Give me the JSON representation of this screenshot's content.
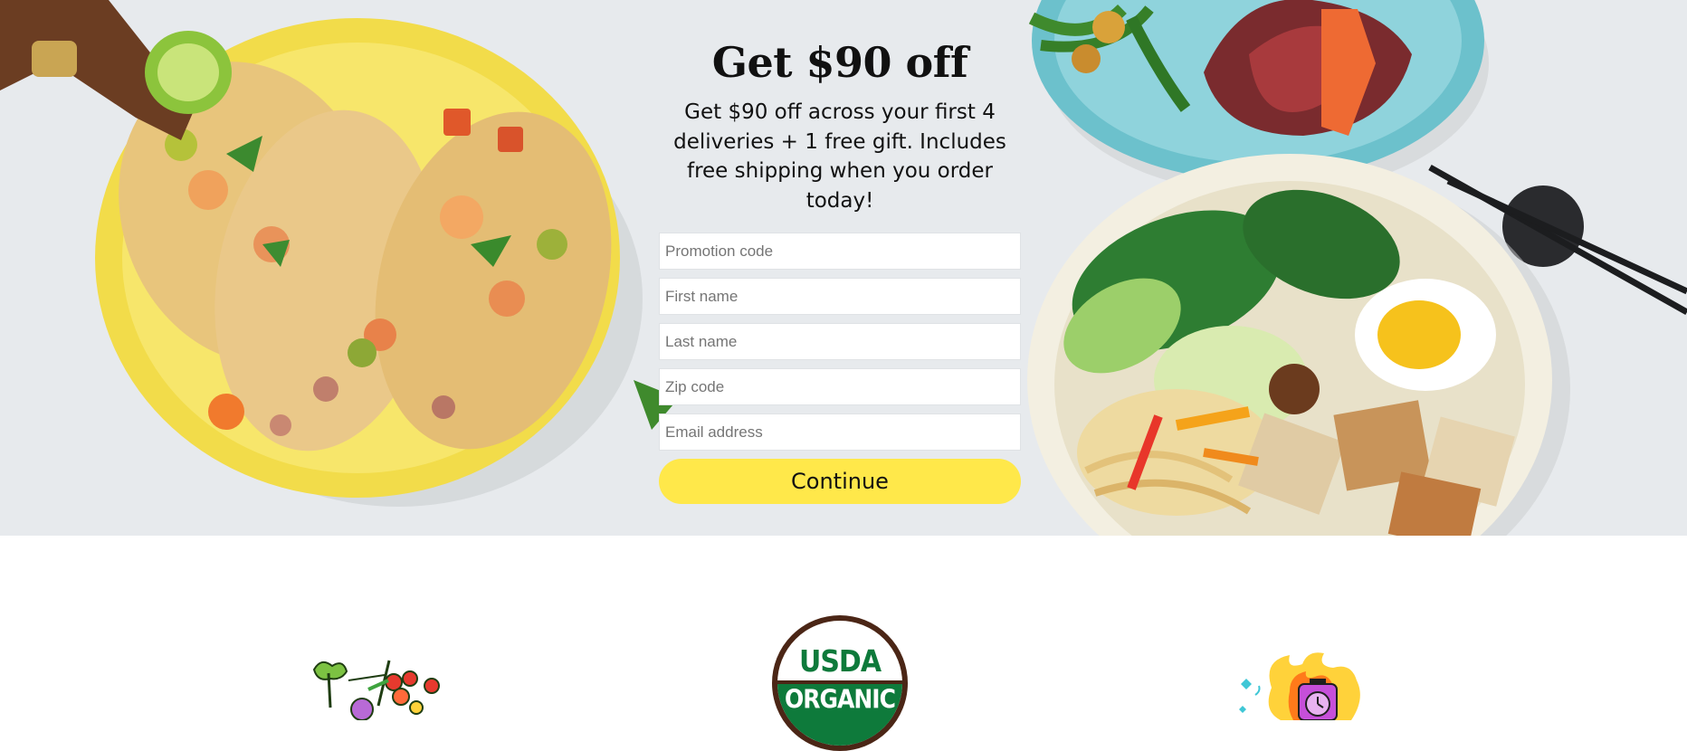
{
  "offer": {
    "headline": "Get $90 off",
    "subhead": "Get $90 off across your first 4 deliveries + 1 free gift. Includes free shipping when you order today!"
  },
  "form": {
    "promotion_code_placeholder": "Promotion code",
    "first_name_placeholder": "First name",
    "last_name_placeholder": "Last name",
    "zip_code_placeholder": "Zip code",
    "email_placeholder": "Email address",
    "continue_label": "Continue"
  },
  "badges": {
    "usda_line1": "USDA",
    "usda_line2": "ORGANIC"
  },
  "colors": {
    "accent_yellow": "#ffe84a",
    "usda_green": "#0e7a3b",
    "usda_brown": "#4b2616"
  },
  "icons": [
    "produce-illustration-icon",
    "usda-organic-seal-icon",
    "clock-flame-illustration-icon"
  ]
}
